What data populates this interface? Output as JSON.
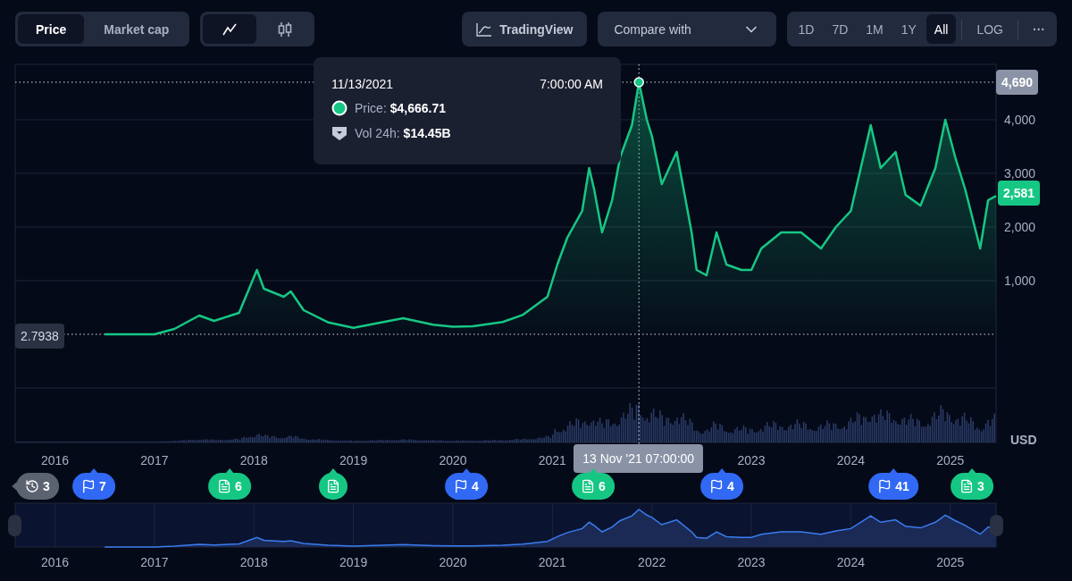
{
  "toolbar": {
    "metric_tabs": [
      {
        "label": "Price",
        "selected": true
      },
      {
        "label": "Market cap",
        "selected": false
      }
    ],
    "chart_type_tabs": [
      {
        "kind": "line",
        "selected": true
      },
      {
        "kind": "candles",
        "selected": false
      }
    ],
    "tradingview_button": {
      "label": "TradingView"
    },
    "compare_select": {
      "placeholder": "Compare with"
    },
    "ranges": [
      {
        "label": "1D",
        "selected": false
      },
      {
        "label": "7D",
        "selected": false
      },
      {
        "label": "1M",
        "selected": false
      },
      {
        "label": "1Y",
        "selected": false
      },
      {
        "label": "All",
        "selected": true
      }
    ],
    "log_button": {
      "label": "LOG"
    },
    "more_button": {
      "label": "···"
    }
  },
  "chart": {
    "chart_data": {
      "type": "area",
      "x": [
        2016.5,
        2017,
        2017.2,
        2017.45,
        2017.6,
        2017.85,
        2018.03,
        2018.1,
        2018.3,
        2018.37,
        2018.5,
        2018.75,
        2019,
        2019.5,
        2019.8,
        2020,
        2020.2,
        2020.5,
        2020.7,
        2020.95,
        2021.05,
        2021.15,
        2021.3,
        2021.37,
        2021.42,
        2021.5,
        2021.6,
        2021.68,
        2021.8,
        2021.87,
        2021.95,
        2022,
        2022.1,
        2022.25,
        2022.4,
        2022.45,
        2022.55,
        2022.65,
        2022.75,
        2022.9,
        2023,
        2023.1,
        2023.3,
        2023.5,
        2023.7,
        2023.85,
        2024,
        2024.2,
        2024.3,
        2024.45,
        2024.55,
        2024.7,
        2024.85,
        2024.95,
        2025.05,
        2025.15,
        2025.3,
        2025.38,
        2025.46
      ],
      "xlim": [
        2015.6,
        2025.46
      ],
      "ylim": [
        -2017,
        5033
      ],
      "grid": true,
      "ref_lines": [
        {
          "axis": "y",
          "value": 0
        },
        {
          "axis": "y",
          "value": 4700
        },
        {
          "axis": "x",
          "value": 2021.87
        }
      ],
      "series": [
        {
          "color": "#16c784",
          "values": [
            0,
            0,
            100,
            350,
            250,
            400,
            1200,
            850,
            700,
            800,
            450,
            220,
            120,
            300,
            180,
            140,
            150,
            230,
            360,
            700,
            1300,
            1800,
            2300,
            3100,
            2700,
            1900,
            2500,
            3300,
            3900,
            4700,
            4000,
            3700,
            2800,
            3400,
            1900,
            1200,
            1100,
            1900,
            1300,
            1200,
            1200,
            1600,
            1900,
            1900,
            1600,
            2000,
            2300,
            3900,
            3100,
            3400,
            2600,
            2400,
            3100,
            4000,
            3300,
            2700,
            1600,
            2500,
            2581
          ]
        }
      ],
      "yticks": [
        {
          "value": 1000,
          "label": "1,000"
        },
        {
          "value": 2000,
          "label": "2,000"
        },
        {
          "value": 3000,
          "label": "3,000"
        },
        {
          "value": 4000,
          "label": "4,000"
        }
      ],
      "xticks": [
        {
          "value": 2016,
          "label": "2016"
        },
        {
          "value": 2017,
          "label": "2017"
        },
        {
          "value": 2018,
          "label": "2018"
        },
        {
          "value": 2019,
          "label": "2019"
        },
        {
          "value": 2020,
          "label": "2020"
        },
        {
          "value": 2021,
          "label": "2021"
        },
        {
          "value": 2023,
          "label": "2023"
        },
        {
          "value": 2024,
          "label": "2024"
        },
        {
          "value": 2025,
          "label": "2025"
        }
      ]
    },
    "currency": "USD",
    "start_label": "2.7938",
    "high_badge": "4,690",
    "last_badge": "2,581",
    "crosshair_label": "13 Nov '21 07:00:00",
    "tooltip": {
      "date": "11/13/2021",
      "time": "7:00:00 AM",
      "price_label": "Price:",
      "price_value": "$4,666.71",
      "volume_label": "Vol 24h:",
      "volume_value": "$14.45B"
    }
  },
  "events": [
    {
      "kind": "history",
      "count": "3",
      "color": "#5c6370"
    },
    {
      "kind": "flag",
      "count": "7",
      "color": "#3169f5"
    },
    {
      "kind": "doc",
      "count": "6",
      "color": "#16c784"
    },
    {
      "kind": "doc",
      "color": "#16c784"
    },
    {
      "kind": "flag",
      "count": "4",
      "color": "#3169f5"
    },
    {
      "kind": "doc",
      "count": "6",
      "color": "#16c784"
    },
    {
      "kind": "flag",
      "count": "4",
      "color": "#3169f5"
    },
    {
      "kind": "flag",
      "count": "41",
      "color": "#3169f5"
    },
    {
      "kind": "doc",
      "count": "3",
      "color": "#16c784"
    }
  ],
  "navigator": {
    "labels": [
      "2016",
      "2017",
      "2018",
      "2019",
      "2020",
      "2021",
      "2022",
      "2023",
      "2024",
      "2025"
    ]
  }
}
